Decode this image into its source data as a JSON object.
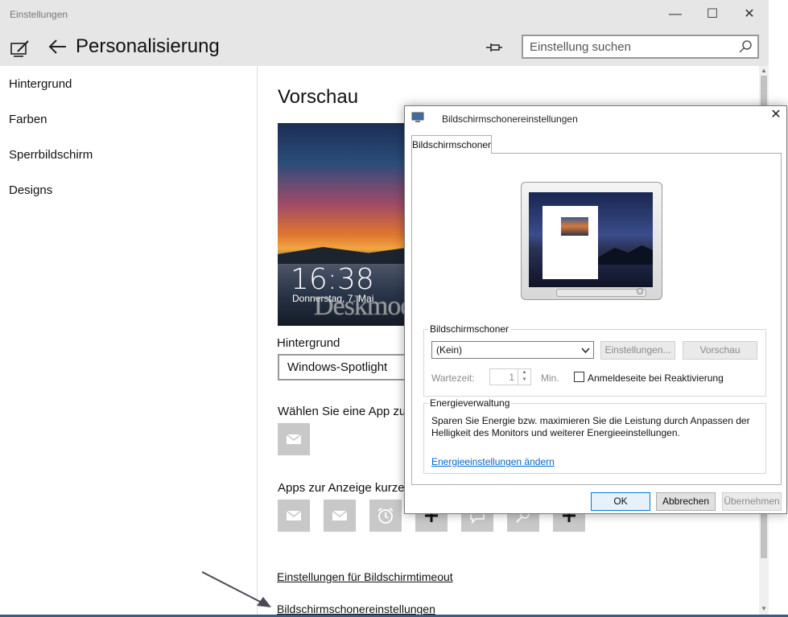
{
  "window": {
    "title": "Einstellungen",
    "minimize_glyph": "—",
    "maximize_glyph": "☐",
    "close_glyph": "✕"
  },
  "header": {
    "page_title": "Personalisierung",
    "search_placeholder": "Einstellung suchen"
  },
  "nav": {
    "items": [
      {
        "label": "Hintergrund"
      },
      {
        "label": "Farben"
      },
      {
        "label": "Sperrbildschirm"
      },
      {
        "label": "Designs"
      }
    ]
  },
  "content": {
    "section_title": "Vorschau",
    "preview_time": "16:38",
    "preview_date": "Donnerstag, 7. Mai",
    "watermark": "Deskmodder.de",
    "background_label": "Hintergrund",
    "background_value": "Windows-Spotlight",
    "choose_app_label": "Wählen Sie eine App zur",
    "apps_label": "Apps zur Anzeige kurzer",
    "timeout_link": "Einstellungen für Bildschirmtimeout",
    "screensaver_link": "Bildschirmschonereinstellungen"
  },
  "dialog": {
    "title": "Bildschirmschonereinstellungen",
    "close_glyph": "✕",
    "tab": "Bildschirmschoner",
    "group_screensaver": "Bildschirmschoner",
    "screensaver_value": "(Kein)",
    "settings_button": "Einstellungen...",
    "preview_button": "Vorschau",
    "wait_label": "Wartezeit:",
    "wait_value": "1",
    "min_label": "Min.",
    "resume_label": "Anmeldeseite bei Reaktivierung",
    "resume_checked": false,
    "group_power": "Energieverwaltung",
    "power_desc": "Sparen Sie Energie bzw. maximieren Sie die Leistung durch Anpassen der Helligkeit des Monitors und weiterer Energieeinstellungen.",
    "power_link": "Energieeinstellungen ändern",
    "ok": "OK",
    "cancel": "Abbrechen",
    "apply": "Übernehmen"
  },
  "colors": {
    "accent_link": "#0066cc",
    "header_bg": "#e6e6e6",
    "tile_bg": "#c8c8c8"
  }
}
